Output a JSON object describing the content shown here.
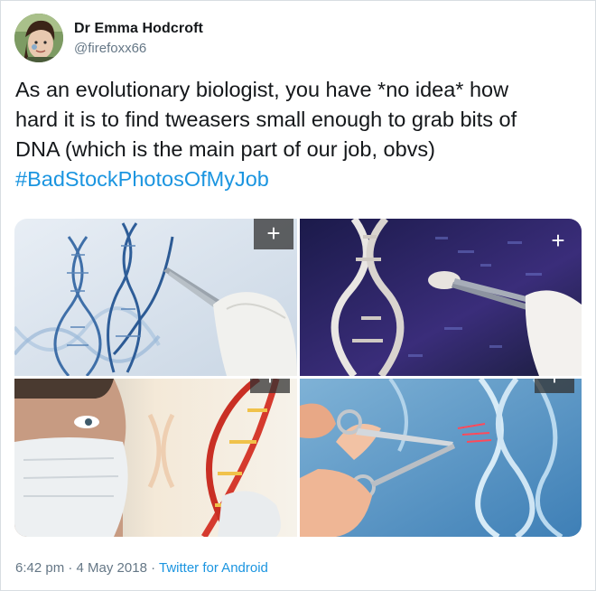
{
  "author": {
    "name": "Dr Emma Hodcroft",
    "handle": "@firefoxx66"
  },
  "tweet": {
    "lines": [
      "As an evolutionary biologist, you have *no idea* how",
      "hard it is to find tweasers small enough to grab bits of",
      "DNA (which is the main part of our job, obvs)"
    ],
    "hashtag": "#BadStockPhotosOfMyJob"
  },
  "media": {
    "expand_label": "+",
    "photos": [
      {
        "name": "tweezers-dna-light-photo"
      },
      {
        "name": "tweezers-dna-dark-photo"
      },
      {
        "name": "masked-scientist-dna-photo"
      },
      {
        "name": "scissors-dna-photo"
      }
    ]
  },
  "footer": {
    "time": "6:42 pm",
    "separator1": " · ",
    "date": "4 May 2018",
    "separator2": " · ",
    "source": "Twitter for Android"
  },
  "colors": {
    "link": "#1b95e0",
    "secondary_text": "#657786",
    "primary_text": "#14171a"
  }
}
